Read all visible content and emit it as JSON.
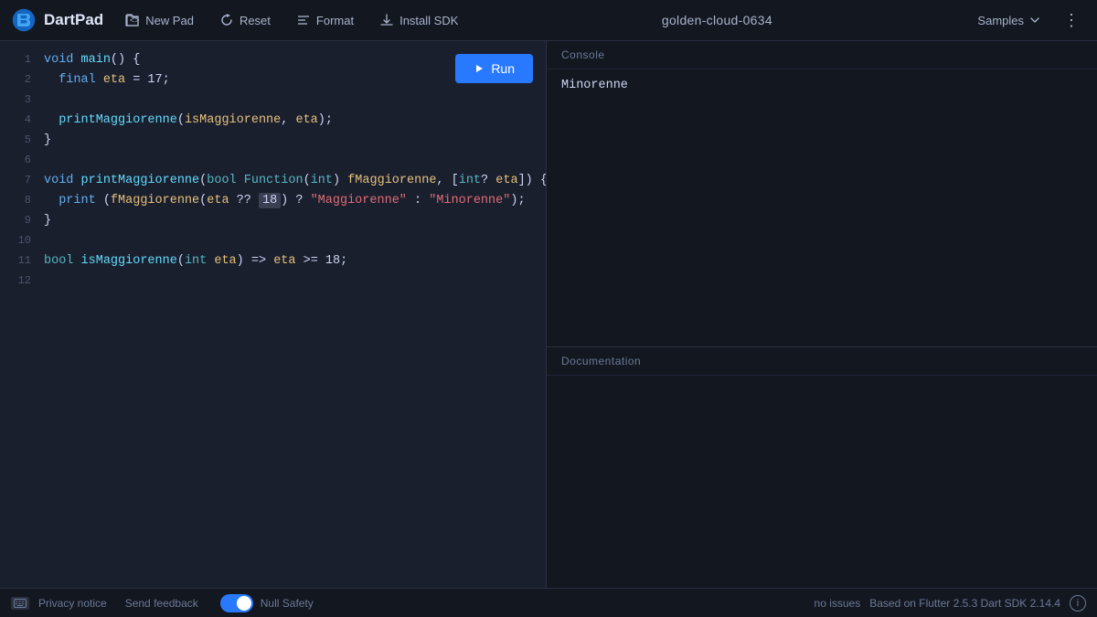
{
  "header": {
    "logo_text": "DartPad",
    "new_pad_label": "New Pad",
    "reset_label": "Reset",
    "format_label": "Format",
    "install_sdk_label": "Install SDK",
    "pad_name": "golden-cloud-0634",
    "samples_label": "Samples",
    "more_icon": "⋮"
  },
  "editor": {
    "run_label": "Run",
    "lines": [
      {
        "num": "1",
        "tokens": [
          {
            "t": "kw",
            "v": "void "
          },
          {
            "t": "fn",
            "v": "main"
          },
          {
            "t": "plain",
            "v": "() {"
          }
        ]
      },
      {
        "num": "2",
        "tokens": [
          {
            "t": "plain",
            "v": "  "
          },
          {
            "t": "kw",
            "v": "final "
          },
          {
            "t": "var",
            "v": "eta"
          },
          {
            "t": "plain",
            "v": " = 17;"
          }
        ]
      },
      {
        "num": "3",
        "tokens": []
      },
      {
        "num": "4",
        "tokens": [
          {
            "t": "plain",
            "v": "  "
          },
          {
            "t": "fn",
            "v": "printMaggiorenne"
          },
          {
            "t": "plain",
            "v": "("
          },
          {
            "t": "var",
            "v": "isMaggiorenne"
          },
          {
            "t": "plain",
            "v": ", "
          },
          {
            "t": "var",
            "v": "eta"
          },
          {
            "t": "plain",
            "v": ");"
          }
        ]
      },
      {
        "num": "5",
        "tokens": [
          {
            "t": "plain",
            "v": "}"
          }
        ]
      },
      {
        "num": "6",
        "tokens": []
      },
      {
        "num": "7",
        "tokens": [
          {
            "t": "kw",
            "v": "void "
          },
          {
            "t": "fn",
            "v": "printMaggiorenne"
          },
          {
            "t": "plain",
            "v": "("
          },
          {
            "t": "type",
            "v": "bool Function"
          },
          {
            "t": "plain",
            "v": "("
          },
          {
            "t": "type",
            "v": "int"
          },
          {
            "t": "plain",
            "v": ") "
          },
          {
            "t": "var",
            "v": "fMaggiorenne"
          },
          {
            "t": "plain",
            "v": ", ["
          },
          {
            "t": "type",
            "v": "int"
          },
          {
            "t": "plain",
            "v": "? "
          },
          {
            "t": "var",
            "v": "eta"
          },
          {
            "t": "plain",
            "v": "]) {"
          }
        ]
      },
      {
        "num": "8",
        "tokens": [
          {
            "t": "plain",
            "v": "  "
          },
          {
            "t": "kw",
            "v": "print "
          },
          {
            "t": "plain",
            "v": "("
          },
          {
            "t": "var",
            "v": "fMaggiorenne"
          },
          {
            "t": "plain",
            "v": "("
          },
          {
            "t": "var",
            "v": "eta"
          },
          {
            "t": "plain",
            "v": " ?? "
          },
          {
            "t": "numhl",
            "v": "18"
          },
          {
            "t": "plain",
            "v": ") ? "
          },
          {
            "t": "str",
            "v": "\"Maggiorenne\""
          },
          {
            "t": "plain",
            "v": " : "
          },
          {
            "t": "str",
            "v": "\"Minorenne\""
          },
          {
            "t": "plain",
            "v": ");"
          }
        ]
      },
      {
        "num": "9",
        "tokens": [
          {
            "t": "plain",
            "v": "}"
          }
        ]
      },
      {
        "num": "10",
        "tokens": []
      },
      {
        "num": "11",
        "tokens": [
          {
            "t": "type",
            "v": "bool "
          },
          {
            "t": "fn",
            "v": "isMaggiorenne"
          },
          {
            "t": "plain",
            "v": "("
          },
          {
            "t": "type",
            "v": "int "
          },
          {
            "t": "var",
            "v": "eta"
          },
          {
            "t": "plain",
            "v": ") => "
          },
          {
            "t": "var",
            "v": "eta"
          },
          {
            "t": "plain",
            "v": " >= 18;"
          }
        ]
      },
      {
        "num": "12",
        "tokens": []
      }
    ]
  },
  "console": {
    "label": "Console",
    "output": "Minorenne"
  },
  "documentation": {
    "label": "Documentation"
  },
  "footer": {
    "privacy_label": "Privacy notice",
    "feedback_label": "Send feedback",
    "null_safety_label": "Null Safety",
    "issues_label": "no issues",
    "flutter_info": "Based on Flutter 2.5.3 Dart SDK 2.14.4",
    "info_icon": "i"
  }
}
